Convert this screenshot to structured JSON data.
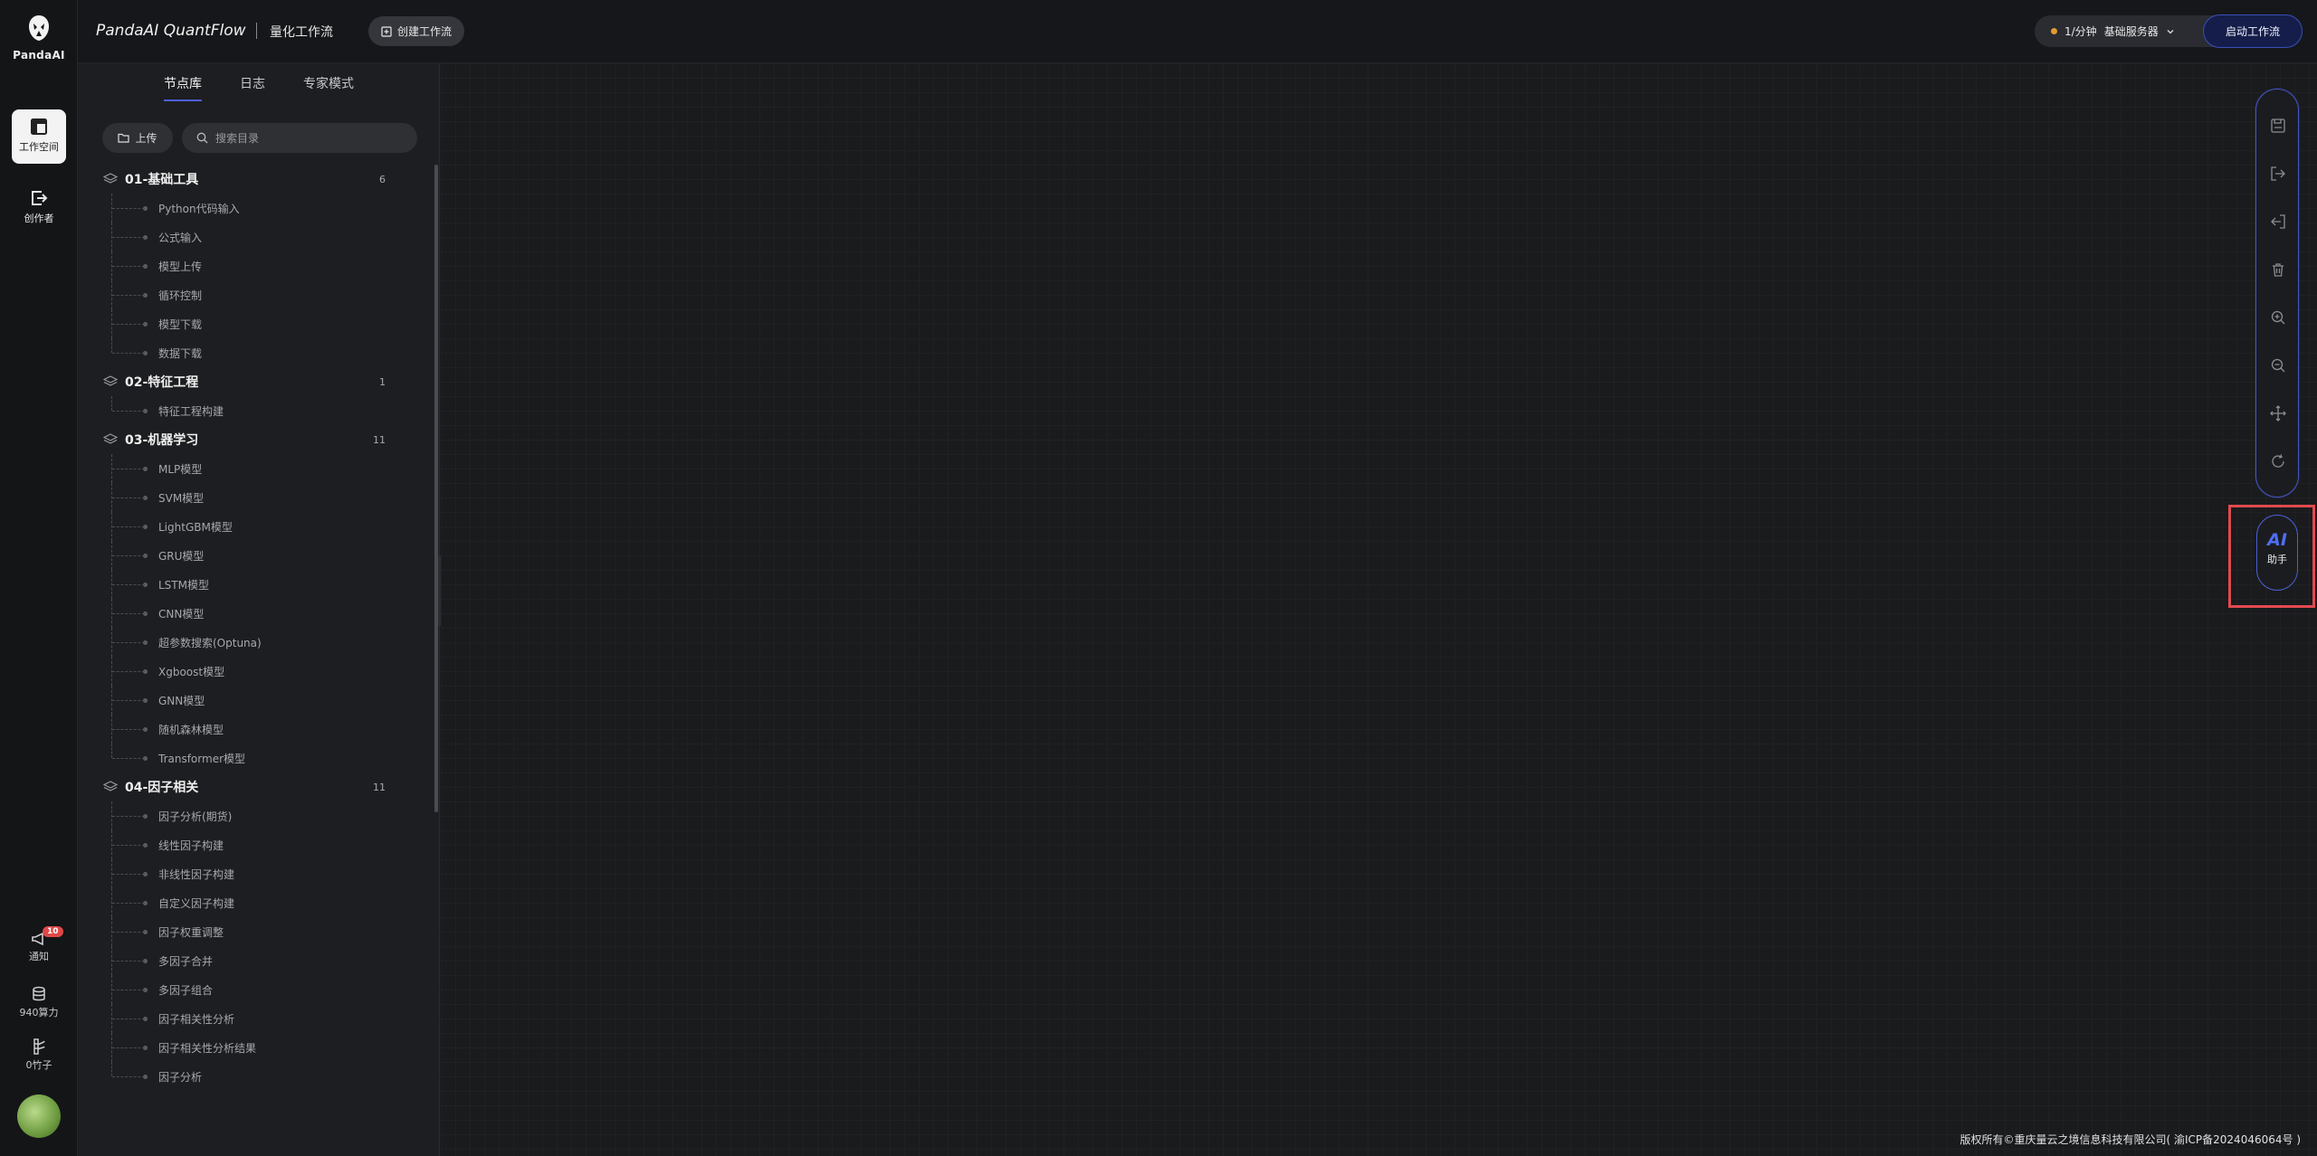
{
  "app": {
    "logo_text": "PandaAI",
    "brand": "PandaAI QuantFlow",
    "subtitle": "量化工作流"
  },
  "rail": {
    "items": [
      {
        "label": "工作空间",
        "icon": "workspace-icon",
        "active": true
      },
      {
        "label": "创作者",
        "icon": "creator-icon",
        "active": false
      }
    ],
    "bottom": [
      {
        "label": "通知",
        "icon": "megaphone-icon",
        "badge": "10"
      },
      {
        "label": "940算力",
        "icon": "database-icon"
      },
      {
        "label": "0竹子",
        "icon": "bamboo-icon"
      }
    ]
  },
  "header": {
    "create_label": "创建工作流",
    "server_rate": "1/分钟",
    "server_name": "基础服务器",
    "start_label": "启动工作流"
  },
  "panel": {
    "tabs": [
      "节点库",
      "日志",
      "专家模式"
    ],
    "upload_label": "上传",
    "search_placeholder": "搜索目录",
    "groups": [
      {
        "name": "01-基础工具",
        "count": "6",
        "items": [
          "Python代码输入",
          "公式输入",
          "模型上传",
          "循环控制",
          "模型下载",
          "数据下载"
        ]
      },
      {
        "name": "02-特征工程",
        "count": "1",
        "items": [
          "特征工程构建"
        ]
      },
      {
        "name": "03-机器学习",
        "count": "11",
        "items": [
          "MLP模型",
          "SVM模型",
          "LightGBM模型",
          "GRU模型",
          "LSTM模型",
          "CNN模型",
          "超参数搜索(Optuna)",
          "Xgboost模型",
          "GNN模型",
          "随机森林模型",
          "Transformer模型"
        ]
      },
      {
        "name": "04-因子相关",
        "count": "11",
        "items": [
          "因子分析(期货)",
          "线性因子构建",
          "非线性因子构建",
          "自定义因子构建",
          "因子权重调整",
          "多因子合并",
          "多因子组合",
          "因子相关性分析",
          "因子相关性分析结果",
          "因子分析"
        ]
      }
    ]
  },
  "toolbar": {
    "tools": [
      "save-icon",
      "export-icon",
      "import-icon",
      "delete-icon",
      "zoom-in-icon",
      "zoom-out-icon",
      "fit-view-icon",
      "refresh-icon"
    ]
  },
  "ai": {
    "mark": "AI",
    "label": "助手"
  },
  "footer": {
    "text": "版权所有©重庆量云之境信息科技有限公司( 渝ICP备2024046064号 )"
  }
}
